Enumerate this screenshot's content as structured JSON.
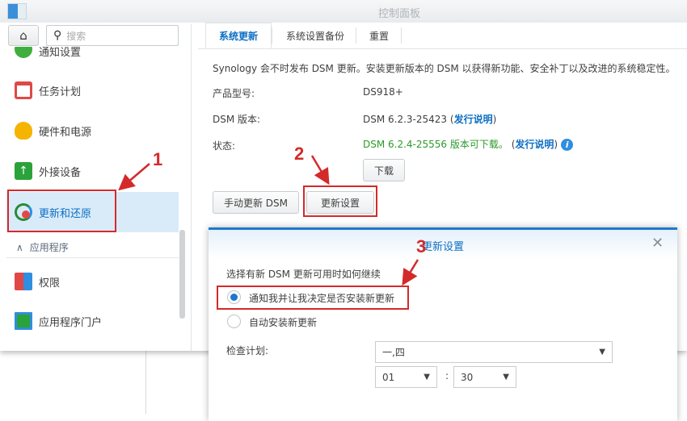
{
  "window": {
    "title": "控制面板"
  },
  "sidebar": {
    "search_placeholder": "搜索",
    "items": [
      {
        "label": "通知设置",
        "icon": "notification-icon"
      },
      {
        "label": "任务计划",
        "icon": "calendar-icon"
      },
      {
        "label": "硬件和电源",
        "icon": "lightbulb-icon"
      },
      {
        "label": "外接设备",
        "icon": "external-device-icon"
      },
      {
        "label": "更新和还原",
        "icon": "update-restore-icon",
        "selected": true
      }
    ],
    "section": "应用程序",
    "section_items": [
      {
        "label": "权限",
        "icon": "privileges-icon"
      },
      {
        "label": "应用程序门户",
        "icon": "app-portal-icon"
      }
    ]
  },
  "tabs": [
    {
      "label": "系统更新",
      "selected": true
    },
    {
      "label": "系统设置备份"
    },
    {
      "label": "重置"
    }
  ],
  "main": {
    "intro": "Synology 会不时发布 DSM 更新。安装更新版本的 DSM 以获得新功能、安全补丁以及改进的系统稳定性。",
    "model_label": "产品型号:",
    "model_value": "DS918+",
    "version_label": "DSM 版本:",
    "version_value": "DSM 6.2.3-25423",
    "release_notes": "发行说明",
    "status_label": "状态:",
    "status_value": "DSM 6.2.4-25556 版本可下载。",
    "download": "下载",
    "manual_update": "手动更新 DSM",
    "update_settings": "更新设置"
  },
  "dialog": {
    "title": "更新设置",
    "question": "选择有新 DSM 更新可用时如何继续",
    "option1": "通知我并让我决定是否安装新更新",
    "option2": "自动安装新更新",
    "selected_option": 1,
    "schedule_label": "检查计划:",
    "days": "一,四",
    "hour": "01",
    "minute": "30",
    "colon": ":"
  },
  "annotations": [
    "1",
    "2",
    "3"
  ],
  "colors": {
    "accent": "#0d6fc4",
    "annotation": "#d42a2a",
    "status_green": "#2a9a2a"
  }
}
